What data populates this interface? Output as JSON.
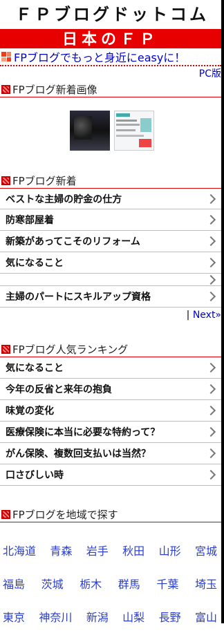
{
  "site": {
    "title": "ＦＰブログドットコム",
    "banner": "日本のＦＰ",
    "tagline": "FPブログでもっと身近にeasyに！",
    "pc_link": "PC版"
  },
  "sections": {
    "images_title": "FPブログ新着画像",
    "new_title": "FPブログ新着",
    "ranking_title": "FPブログ人気ランキング",
    "region_title": "FPブログを地域で探す"
  },
  "new_posts": [
    "ベストな主婦の貯金の仕方",
    "防寒部屋着",
    "新築があってこそのリフォーム",
    "気になること",
    "",
    "主婦のパートにスキルアップ資格"
  ],
  "next": {
    "separator": "|",
    "label": "Next»"
  },
  "ranking": [
    "気になること",
    "今年の反省と来年の抱負",
    "味覚の変化",
    "医療保険に本当に必要な特約って？",
    "がん保険、複数回支払いは当然？",
    "口さびしい時"
  ],
  "regions": [
    [
      "北海道",
      "青森",
      "岩手",
      "秋田",
      "山形",
      "宮城"
    ],
    [
      "福島",
      "茨城",
      "栃木",
      "群馬",
      "千葉",
      "埼玉"
    ],
    [
      "東京",
      "神奈川",
      "新潟",
      "山梨",
      "長野",
      "富山"
    ]
  ],
  "colors": {
    "brand_red": "#e60000",
    "link_blue": "#0000cc",
    "region_blue": "#2a3fd0"
  }
}
